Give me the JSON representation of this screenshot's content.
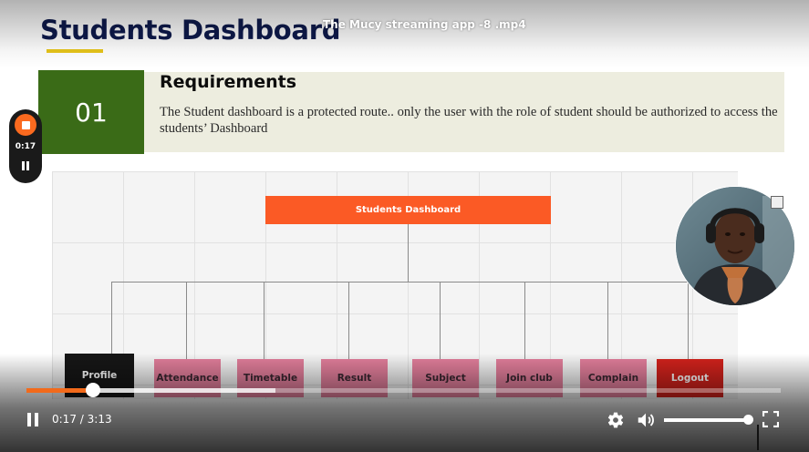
{
  "video": {
    "file_name": "The Mucy streaming app -8 .mp4"
  },
  "slide": {
    "title": "Students Dashboard",
    "requirement": {
      "number": "01",
      "heading": "Requirements",
      "body": "The Student dashboard is a protected route.. only the user with the role of student should be authorized to access the students’ Dashboard"
    },
    "diagram": {
      "root": "Students Dashboard",
      "children": [
        "Profile",
        "Attendance",
        "Timetable",
        "Result",
        "Subject",
        "Join club",
        "Complain",
        "Logout"
      ]
    }
  },
  "recorder": {
    "elapsed": "0:17",
    "stop_icon": "stop-icon",
    "pause_icon": "pause-icon"
  },
  "player": {
    "current_time": "0:17",
    "time_separator": "/",
    "duration": "3:13",
    "progress_fraction": 0.088,
    "buffered_fraction": 0.33,
    "volume_fraction": 1.0,
    "icons": [
      "pause-icon",
      "settings-gear-icon",
      "volume-icon",
      "fullscreen-icon"
    ]
  },
  "colors": {
    "accent_orange": "#f26a1b",
    "title_navy": "#0e1a4d",
    "number_box_green": "#3a6b17",
    "diagram_orange": "#fb5a25",
    "node_pink": "#e27e9b",
    "logout_red": "#d2221c"
  }
}
